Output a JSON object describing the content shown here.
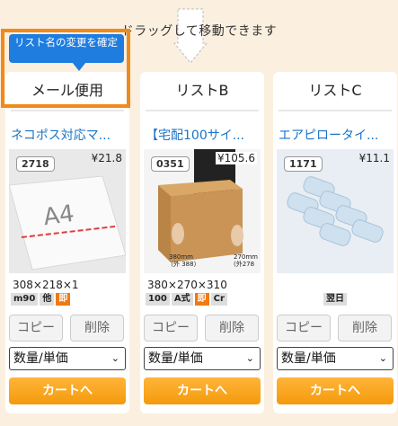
{
  "drag_hint": "ドラッグして移動できます",
  "tooltip": "リスト名の変更を確定",
  "columns": [
    {
      "list_name": "メール便用",
      "product_name": "ネコポス対応マ...",
      "code": "2718",
      "price": "¥21.8",
      "size": "308×218×1",
      "tags": [
        "m90",
        "他",
        "即"
      ],
      "copy_label": "コピー",
      "delete_label": "削除",
      "select_value": "数量/単価",
      "cart_label": "カートへ"
    },
    {
      "list_name": "リストB",
      "product_name": "【宅配100サイ...",
      "code": "0351",
      "price": "¥105.6",
      "size": "380×270×310",
      "tags": [
        "100",
        "A式",
        "即",
        "Cr"
      ],
      "copy_label": "コピー",
      "delete_label": "削除",
      "select_value": "数量/単価",
      "cart_label": "カートへ"
    },
    {
      "list_name": "リストC",
      "product_name": "エアピロータイ...",
      "code": "1171",
      "price": "¥11.1",
      "size": "",
      "tags": [
        "翌日"
      ],
      "copy_label": "コピー",
      "delete_label": "削除",
      "select_value": "数量/単価",
      "cart_label": "カートへ"
    }
  ],
  "photo_texts": {
    "envelope_label": "A4",
    "box_dim_1": "380mm",
    "box_dim_1b": "（外 388）",
    "box_dim_2": "270mm",
    "box_dim_2b": "(外278"
  },
  "colors": {
    "accent_orange": "#f08a1c",
    "tooltip_blue": "#1f7de0",
    "link_blue": "#1a74c9",
    "background": "#fbf0df"
  }
}
